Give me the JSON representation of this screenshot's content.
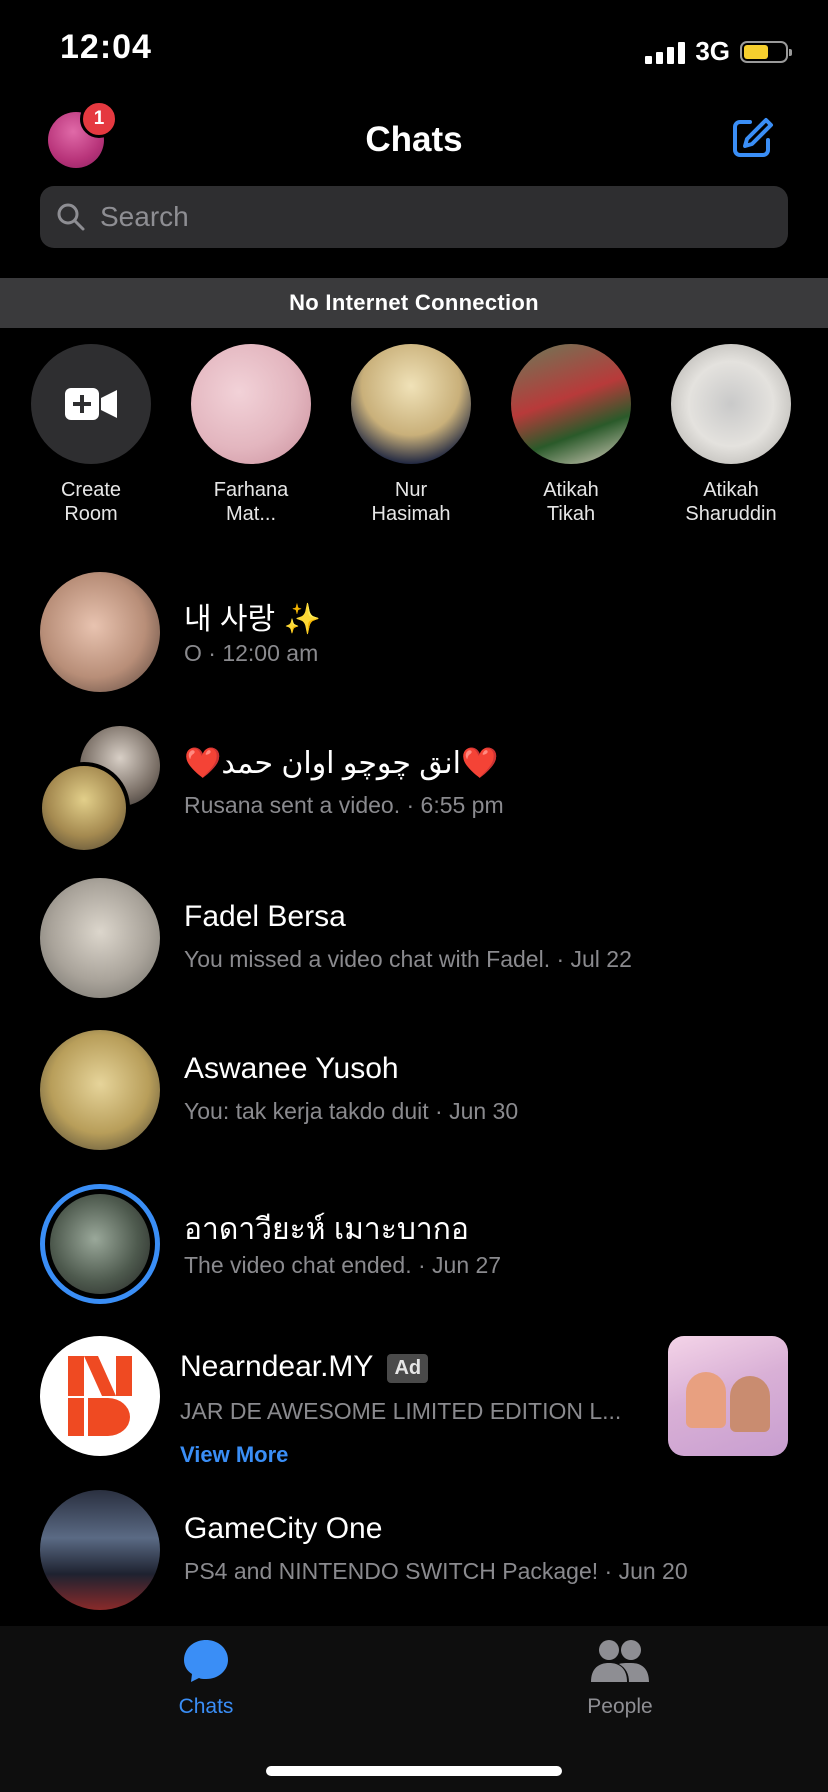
{
  "status_bar": {
    "time": "12:04",
    "network": "3G"
  },
  "header": {
    "title": "Chats",
    "notification_count": "1"
  },
  "search": {
    "placeholder": "Search"
  },
  "banner": {
    "text": "No Internet Connection"
  },
  "stories": [
    {
      "line1": "Create",
      "line2": "Room"
    },
    {
      "line1": "Farhana",
      "line2": "Mat..."
    },
    {
      "line1": "Nur",
      "line2": "Hasimah"
    },
    {
      "line1": "Atikah",
      "line2": "Tikah"
    },
    {
      "line1": "Atikah",
      "line2": "Sharuddin"
    }
  ],
  "chats": [
    {
      "title": "내 사랑 ✨",
      "subtitle": "O · 12:00 am"
    },
    {
      "title": "❤️انق چوچو اوان حمد❤️",
      "subtitle": "Rusana sent a video. · 6:55 pm"
    },
    {
      "title": "Fadel Bersa",
      "subtitle": "You missed a video chat with Fadel. · Jul 22"
    },
    {
      "title": "Aswanee Yusoh",
      "subtitle": "You: tak kerja takdo duit · Jun 30"
    },
    {
      "title": "อาดาวียะห์ เมาะบากอ",
      "subtitle": "The video chat ended. · Jun 27"
    },
    {
      "title": "Nearndear.MY",
      "badge": "Ad",
      "subtitle": "JAR DE AWESOME LIMITED EDITION L...",
      "link": "View More"
    },
    {
      "title": "GameCity One",
      "subtitle": "PS4 and NINTENDO SWITCH Package! · Jun 20"
    }
  ],
  "tabs": [
    {
      "label": "Chats",
      "icon": "chat-bubble-icon",
      "active": true
    },
    {
      "label": "People",
      "icon": "people-icon",
      "active": false
    }
  ],
  "colors": {
    "accent": "#3a8ef6",
    "banner": "#3a3a3c",
    "story_ring": "#3a8ef6",
    "badge": "#e53940"
  }
}
